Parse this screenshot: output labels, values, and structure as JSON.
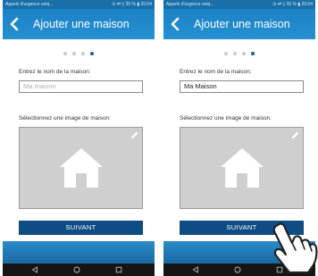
{
  "status": {
    "left_text": "Appels d'urgence uniq...",
    "right_text": "⊙ ⇄ ▯ 35 % ▮ 20:04"
  },
  "app": {
    "title": "Ajouter une maison",
    "back_icon": "back-arrow-icon"
  },
  "steps": {
    "total": 4,
    "current": 4
  },
  "form": {
    "name_label": "Entrez le nom de la maison:",
    "name_placeholder": "Ma maison",
    "name_value": "Ma Maison",
    "image_label": "Sélectionnez une image de maison:",
    "edit_icon": "pencil-icon",
    "image_icon": "house-icon"
  },
  "buttons": {
    "next_label": "SUIVANT"
  },
  "nav": {
    "back_icon": "nav-back-icon",
    "home_icon": "nav-home-icon",
    "recent_icon": "nav-recent-icon"
  },
  "overlay": {
    "pointer_icon": "hand-pointer-icon"
  },
  "colors": {
    "appbar": "#2590d2",
    "button": "#0f4c84",
    "active_dot": "#1b5e96",
    "image_bg": "#cfcfcf"
  }
}
